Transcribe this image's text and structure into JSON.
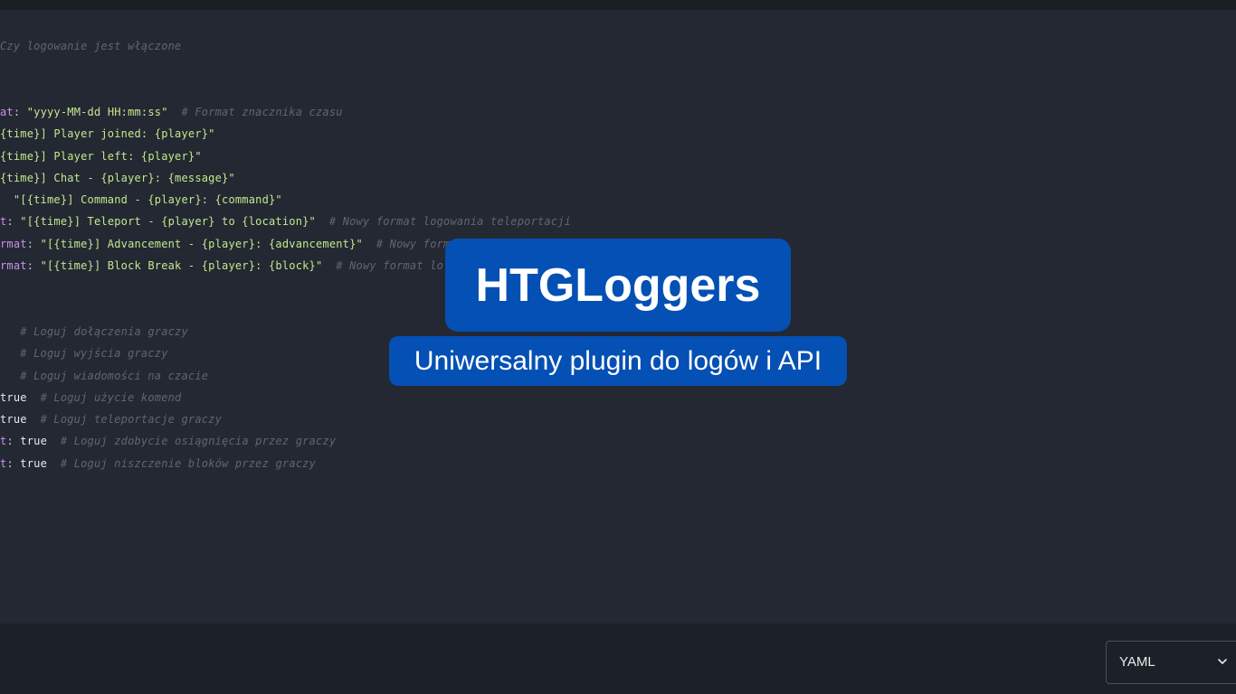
{
  "editor": {
    "lines": [
      {
        "parts": [
          {
            "t": "com",
            "v": "Czy logowanie jest włączone"
          }
        ]
      },
      {
        "parts": []
      },
      {
        "parts": []
      },
      {
        "parts": [
          {
            "t": "key",
            "v": "at"
          },
          {
            "t": "punc",
            "v": ": "
          },
          {
            "t": "str",
            "v": "\"yyyy-MM-dd HH:mm:ss\""
          },
          {
            "t": "punc",
            "v": "  "
          },
          {
            "t": "com",
            "v": "# Format znacznika czasu"
          }
        ]
      },
      {
        "parts": [
          {
            "t": "str",
            "v": "{time}] Player joined: {player}\""
          }
        ]
      },
      {
        "parts": [
          {
            "t": "str",
            "v": "{time}] Player left: {player}\""
          }
        ]
      },
      {
        "parts": [
          {
            "t": "str",
            "v": "{time}] Chat - {player}: {message}\""
          }
        ]
      },
      {
        "parts": [
          {
            "t": "punc",
            "v": "  "
          },
          {
            "t": "str",
            "v": "\"[{time}] Command - {player}: {command}\""
          }
        ]
      },
      {
        "parts": [
          {
            "t": "key",
            "v": "t"
          },
          {
            "t": "punc",
            "v": ": "
          },
          {
            "t": "str",
            "v": "\"[{time}] Teleport - {player} to {location}\""
          },
          {
            "t": "punc",
            "v": "  "
          },
          {
            "t": "com",
            "v": "# Nowy format logowania teleportacji"
          }
        ]
      },
      {
        "parts": [
          {
            "t": "key",
            "v": "rmat"
          },
          {
            "t": "punc",
            "v": ": "
          },
          {
            "t": "str",
            "v": "\"[{time}] Advancement - {player}: {advancement}\""
          },
          {
            "t": "punc",
            "v": "  "
          },
          {
            "t": "com",
            "v": "# Nowy format"
          }
        ]
      },
      {
        "parts": [
          {
            "t": "key",
            "v": "rmat"
          },
          {
            "t": "punc",
            "v": ": "
          },
          {
            "t": "str",
            "v": "\"[{time}] Block Break - {player}: {block}\""
          },
          {
            "t": "punc",
            "v": "  "
          },
          {
            "t": "com",
            "v": "# Nowy format lo"
          }
        ]
      },
      {
        "parts": []
      },
      {
        "parts": []
      },
      {
        "parts": [
          {
            "t": "punc",
            "v": "   "
          },
          {
            "t": "com",
            "v": "# Loguj dołączenia graczy"
          }
        ]
      },
      {
        "parts": [
          {
            "t": "punc",
            "v": "   "
          },
          {
            "t": "com",
            "v": "# Loguj wyjścia graczy"
          }
        ]
      },
      {
        "parts": [
          {
            "t": "punc",
            "v": "   "
          },
          {
            "t": "com",
            "v": "# Loguj wiadomości na czacie"
          }
        ]
      },
      {
        "parts": [
          {
            "t": "bool",
            "v": "true"
          },
          {
            "t": "punc",
            "v": "  "
          },
          {
            "t": "com",
            "v": "# Loguj użycie komend"
          }
        ]
      },
      {
        "parts": [
          {
            "t": "bool",
            "v": "true"
          },
          {
            "t": "punc",
            "v": "  "
          },
          {
            "t": "com",
            "v": "# Loguj teleportacje graczy"
          }
        ]
      },
      {
        "parts": [
          {
            "t": "key",
            "v": "t"
          },
          {
            "t": "punc",
            "v": ": "
          },
          {
            "t": "bool",
            "v": "true"
          },
          {
            "t": "punc",
            "v": "  "
          },
          {
            "t": "com",
            "v": "# Loguj zdobycie osiągnięcia przez graczy"
          }
        ]
      },
      {
        "parts": [
          {
            "t": "key",
            "v": "t"
          },
          {
            "t": "punc",
            "v": ": "
          },
          {
            "t": "bool",
            "v": "true"
          },
          {
            "t": "punc",
            "v": "  "
          },
          {
            "t": "com",
            "v": "# Loguj niszczenie bloków przez graczy"
          }
        ]
      }
    ]
  },
  "language_select": {
    "value": "YAML",
    "icon": "chevron-down-icon"
  },
  "overlay": {
    "title": "HTGLoggers",
    "subtitle": "Uniwersalny plugin do logów i API"
  },
  "colors": {
    "badge": "#0450b4",
    "string": "#c3e88d",
    "key": "#c792ea",
    "comment": "#5c6773",
    "background": "#242833"
  }
}
